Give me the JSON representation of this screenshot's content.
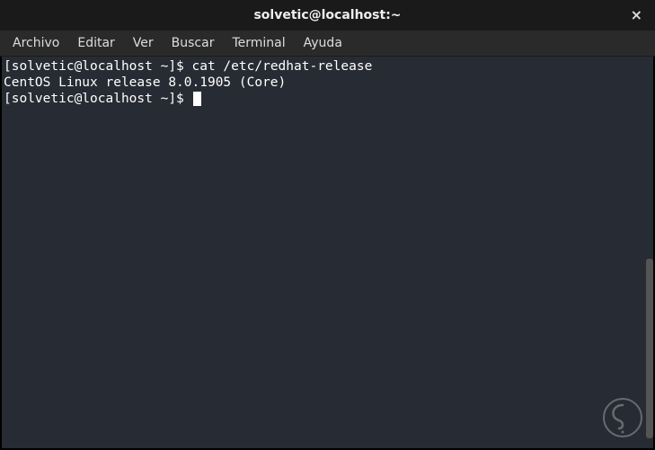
{
  "titlebar": {
    "title": "solvetic@localhost:~",
    "close_label": "×"
  },
  "menubar": {
    "items": [
      {
        "label": "Archivo"
      },
      {
        "label": "Editar"
      },
      {
        "label": "Ver"
      },
      {
        "label": "Buscar"
      },
      {
        "label": "Terminal"
      },
      {
        "label": "Ayuda"
      }
    ]
  },
  "terminal": {
    "lines": [
      {
        "prompt": "[solvetic@localhost ~]$ ",
        "command": "cat /etc/redhat-release"
      },
      {
        "output": "CentOS Linux release 8.0.1905 (Core)"
      },
      {
        "prompt": "[solvetic@localhost ~]$ ",
        "command": ""
      }
    ]
  }
}
